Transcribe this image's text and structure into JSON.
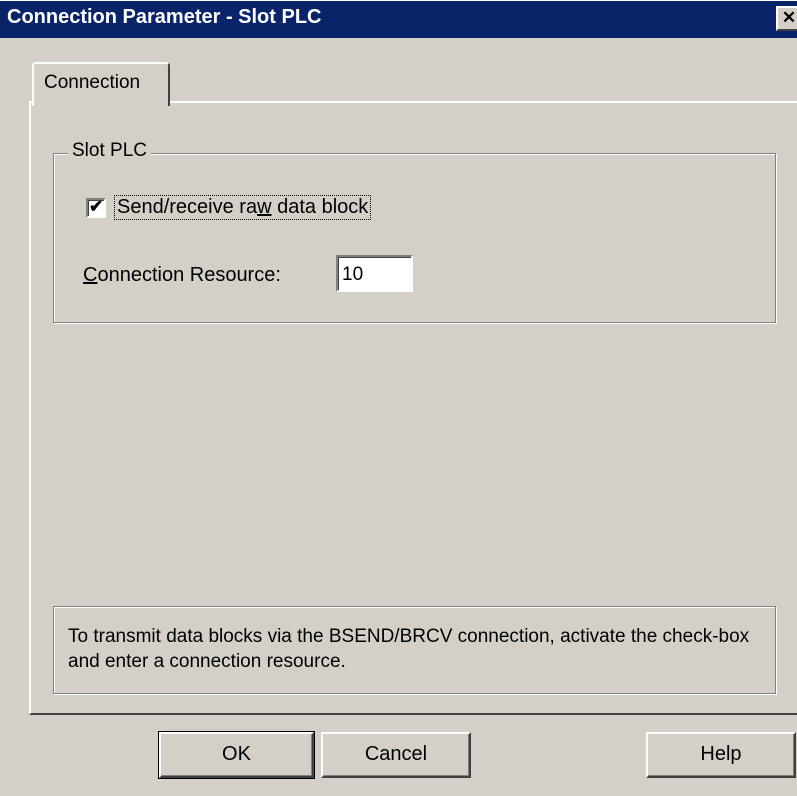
{
  "window": {
    "title": "Connection Parameter - Slot PLC",
    "close_glyph": "✕"
  },
  "tabs": [
    {
      "label": "Connection",
      "selected": true
    }
  ],
  "slot_group": {
    "legend": "Slot PLC",
    "checkbox": {
      "label_before": "Send/receive ra",
      "label_accel": "w",
      "label_after": " data block",
      "checked": true,
      "check_glyph": "✔"
    },
    "resource": {
      "label_accel": "C",
      "label_rest": "onnection Resource:",
      "value": "10"
    }
  },
  "info": {
    "text": "To transmit data blocks via the BSEND/BRCV connection, activate the check-box and enter a connection resource."
  },
  "buttons": {
    "ok": "OK",
    "cancel": "Cancel",
    "help": "Help"
  },
  "colors": {
    "titlebar": "#0a246a",
    "face": "#d4d0c8"
  },
  "icons": {
    "close": "close-icon",
    "check": "checkmark-icon"
  }
}
